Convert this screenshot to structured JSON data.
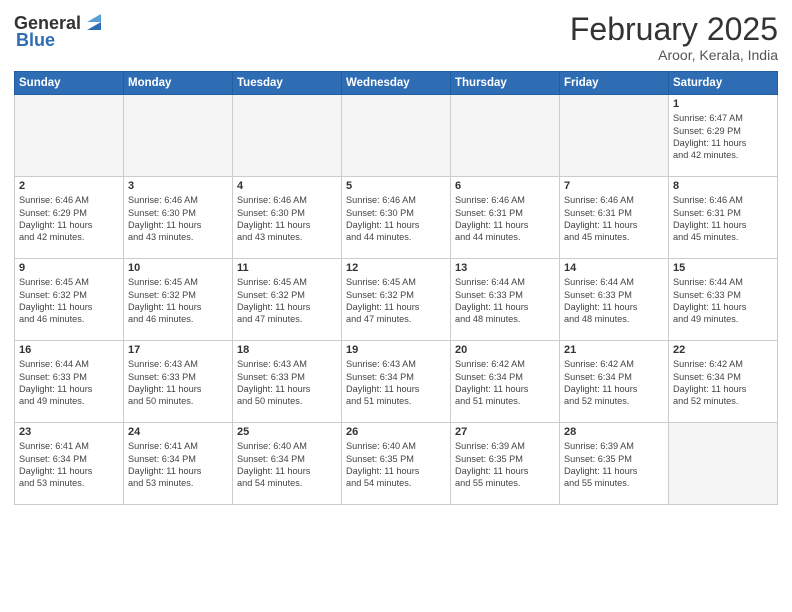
{
  "header": {
    "logo_general": "General",
    "logo_blue": "Blue",
    "month_title": "February 2025",
    "location": "Aroor, Kerala, India"
  },
  "days_of_week": [
    "Sunday",
    "Monday",
    "Tuesday",
    "Wednesday",
    "Thursday",
    "Friday",
    "Saturday"
  ],
  "weeks": [
    [
      {
        "day": "",
        "info": ""
      },
      {
        "day": "",
        "info": ""
      },
      {
        "day": "",
        "info": ""
      },
      {
        "day": "",
        "info": ""
      },
      {
        "day": "",
        "info": ""
      },
      {
        "day": "",
        "info": ""
      },
      {
        "day": "1",
        "info": "Sunrise: 6:47 AM\nSunset: 6:29 PM\nDaylight: 11 hours\nand 42 minutes."
      }
    ],
    [
      {
        "day": "2",
        "info": "Sunrise: 6:46 AM\nSunset: 6:29 PM\nDaylight: 11 hours\nand 42 minutes."
      },
      {
        "day": "3",
        "info": "Sunrise: 6:46 AM\nSunset: 6:30 PM\nDaylight: 11 hours\nand 43 minutes."
      },
      {
        "day": "4",
        "info": "Sunrise: 6:46 AM\nSunset: 6:30 PM\nDaylight: 11 hours\nand 43 minutes."
      },
      {
        "day": "5",
        "info": "Sunrise: 6:46 AM\nSunset: 6:30 PM\nDaylight: 11 hours\nand 44 minutes."
      },
      {
        "day": "6",
        "info": "Sunrise: 6:46 AM\nSunset: 6:31 PM\nDaylight: 11 hours\nand 44 minutes."
      },
      {
        "day": "7",
        "info": "Sunrise: 6:46 AM\nSunset: 6:31 PM\nDaylight: 11 hours\nand 45 minutes."
      },
      {
        "day": "8",
        "info": "Sunrise: 6:46 AM\nSunset: 6:31 PM\nDaylight: 11 hours\nand 45 minutes."
      }
    ],
    [
      {
        "day": "9",
        "info": "Sunrise: 6:45 AM\nSunset: 6:32 PM\nDaylight: 11 hours\nand 46 minutes."
      },
      {
        "day": "10",
        "info": "Sunrise: 6:45 AM\nSunset: 6:32 PM\nDaylight: 11 hours\nand 46 minutes."
      },
      {
        "day": "11",
        "info": "Sunrise: 6:45 AM\nSunset: 6:32 PM\nDaylight: 11 hours\nand 47 minutes."
      },
      {
        "day": "12",
        "info": "Sunrise: 6:45 AM\nSunset: 6:32 PM\nDaylight: 11 hours\nand 47 minutes."
      },
      {
        "day": "13",
        "info": "Sunrise: 6:44 AM\nSunset: 6:33 PM\nDaylight: 11 hours\nand 48 minutes."
      },
      {
        "day": "14",
        "info": "Sunrise: 6:44 AM\nSunset: 6:33 PM\nDaylight: 11 hours\nand 48 minutes."
      },
      {
        "day": "15",
        "info": "Sunrise: 6:44 AM\nSunset: 6:33 PM\nDaylight: 11 hours\nand 49 minutes."
      }
    ],
    [
      {
        "day": "16",
        "info": "Sunrise: 6:44 AM\nSunset: 6:33 PM\nDaylight: 11 hours\nand 49 minutes."
      },
      {
        "day": "17",
        "info": "Sunrise: 6:43 AM\nSunset: 6:33 PM\nDaylight: 11 hours\nand 50 minutes."
      },
      {
        "day": "18",
        "info": "Sunrise: 6:43 AM\nSunset: 6:33 PM\nDaylight: 11 hours\nand 50 minutes."
      },
      {
        "day": "19",
        "info": "Sunrise: 6:43 AM\nSunset: 6:34 PM\nDaylight: 11 hours\nand 51 minutes."
      },
      {
        "day": "20",
        "info": "Sunrise: 6:42 AM\nSunset: 6:34 PM\nDaylight: 11 hours\nand 51 minutes."
      },
      {
        "day": "21",
        "info": "Sunrise: 6:42 AM\nSunset: 6:34 PM\nDaylight: 11 hours\nand 52 minutes."
      },
      {
        "day": "22",
        "info": "Sunrise: 6:42 AM\nSunset: 6:34 PM\nDaylight: 11 hours\nand 52 minutes."
      }
    ],
    [
      {
        "day": "23",
        "info": "Sunrise: 6:41 AM\nSunset: 6:34 PM\nDaylight: 11 hours\nand 53 minutes."
      },
      {
        "day": "24",
        "info": "Sunrise: 6:41 AM\nSunset: 6:34 PM\nDaylight: 11 hours\nand 53 minutes."
      },
      {
        "day": "25",
        "info": "Sunrise: 6:40 AM\nSunset: 6:34 PM\nDaylight: 11 hours\nand 54 minutes."
      },
      {
        "day": "26",
        "info": "Sunrise: 6:40 AM\nSunset: 6:35 PM\nDaylight: 11 hours\nand 54 minutes."
      },
      {
        "day": "27",
        "info": "Sunrise: 6:39 AM\nSunset: 6:35 PM\nDaylight: 11 hours\nand 55 minutes."
      },
      {
        "day": "28",
        "info": "Sunrise: 6:39 AM\nSunset: 6:35 PM\nDaylight: 11 hours\nand 55 minutes."
      },
      {
        "day": "",
        "info": ""
      }
    ]
  ]
}
